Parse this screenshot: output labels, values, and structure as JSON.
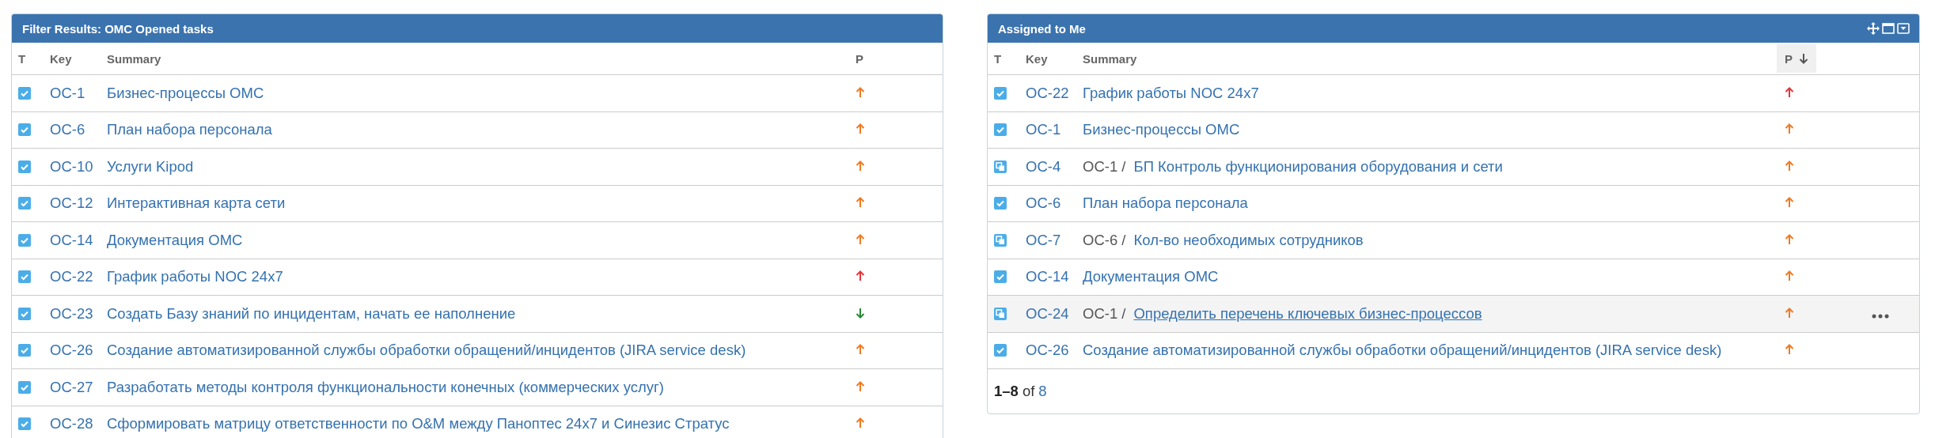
{
  "panels": [
    {
      "title": "Filter Results: OMC Opened tasks",
      "columns": [
        {
          "label": "T",
          "sorted": false
        },
        {
          "label": "Key",
          "sorted": false
        },
        {
          "label": "Summary",
          "sorted": false
        },
        {
          "label": "P",
          "sorted": false
        }
      ],
      "rows": [
        {
          "kind": "task",
          "key": "OC-1",
          "summary": "Бизнес-процессы OMC",
          "priority": {
            "kind": "up",
            "color": "#f07a22"
          },
          "hovered": false
        },
        {
          "kind": "task",
          "key": "OC-6",
          "summary": "План набора персонала",
          "priority": {
            "kind": "up",
            "color": "#f07a22"
          },
          "hovered": false
        },
        {
          "kind": "task",
          "key": "OC-10",
          "summary": "Услуги Kipod",
          "priority": {
            "kind": "up",
            "color": "#f07a22"
          },
          "hovered": false
        },
        {
          "kind": "task",
          "key": "OC-12",
          "summary": "Интерактивная карта сети",
          "priority": {
            "kind": "up",
            "color": "#f07a22"
          },
          "hovered": false
        },
        {
          "kind": "task",
          "key": "OC-14",
          "summary": "Документация OMC",
          "priority": {
            "kind": "up",
            "color": "#f07a22"
          },
          "hovered": false
        },
        {
          "kind": "task",
          "key": "OC-22",
          "summary": "График работы NOC 24x7",
          "priority": {
            "kind": "up",
            "color": "#e5343a"
          },
          "hovered": false
        },
        {
          "kind": "task",
          "key": "OC-23",
          "summary": "Создать Базу знаний по инцидентам, начать ее наполнение",
          "priority": {
            "kind": "down",
            "color": "#2a8735"
          },
          "hovered": false
        },
        {
          "kind": "task",
          "key": "OC-26",
          "summary": "Создание автоматизированной службы обработки обращений/инцидентов (JIRA service desk)",
          "priority": {
            "kind": "up",
            "color": "#f07a22"
          },
          "hovered": false
        },
        {
          "kind": "task",
          "key": "OC-27",
          "summary": "Разработать методы контроля функциональности конечных (коммерческих услуг)",
          "priority": {
            "kind": "up",
            "color": "#f07a22"
          },
          "hovered": false
        },
        {
          "kind": "task",
          "key": "OC-28",
          "summary": "Сформировать матрицу ответственности по O&M между Паноптес 24x7 и Синезис Стратус",
          "priority": {
            "kind": "up",
            "color": "#f07a22"
          },
          "hovered": false
        }
      ]
    },
    {
      "title": "Assigned to Me",
      "header_icons": [
        {
          "kind": "move"
        },
        {
          "kind": "maximize"
        },
        {
          "kind": "dropdown"
        }
      ],
      "columns": [
        {
          "label": "T",
          "sorted": false
        },
        {
          "label": "Key",
          "sorted": false
        },
        {
          "label": "Summary",
          "sorted": false
        },
        {
          "label": "P",
          "sorted": true
        }
      ],
      "rows": [
        {
          "kind": "task",
          "key": "OC-22",
          "summary": "График работы NOC 24x7",
          "priority": {
            "kind": "up",
            "color": "#e5343a"
          },
          "hovered": false
        },
        {
          "kind": "task",
          "key": "OC-1",
          "summary": "Бизнес-процессы OMC",
          "priority": {
            "kind": "up",
            "color": "#f07a22"
          },
          "hovered": false
        },
        {
          "kind": "subtask",
          "parent": "OC-1 /",
          "key": "OC-4",
          "summary": "БП Контроль функционирования оборудования и сети",
          "priority": {
            "kind": "up",
            "color": "#f07a22"
          },
          "hovered": false
        },
        {
          "kind": "task",
          "key": "OC-6",
          "summary": "План набора персонала",
          "priority": {
            "kind": "up",
            "color": "#f07a22"
          },
          "hovered": false
        },
        {
          "kind": "subtask",
          "parent": "OC-6 /",
          "key": "OC-7",
          "summary": "Кол-во необходимых сотрудников",
          "priority": {
            "kind": "up",
            "color": "#f07a22"
          },
          "hovered": false
        },
        {
          "kind": "task",
          "key": "OC-14",
          "summary": "Документация OMC",
          "priority": {
            "kind": "up",
            "color": "#f07a22"
          },
          "hovered": false
        },
        {
          "kind": "subtask",
          "parent": "OC-1 /",
          "key": "OC-24",
          "summary": "Определить перечень ключевых бизнес-процессов",
          "priority": {
            "kind": "up",
            "color": "#f07a22"
          },
          "hovered": true
        },
        {
          "kind": "task",
          "key": "OC-26",
          "summary": "Создание автоматизированной службы обработки обращений/инцидентов (JIRA service desk)",
          "priority": {
            "kind": "up",
            "color": "#f07a22"
          },
          "hovered": false
        }
      ],
      "pagination": {
        "range": "1–8",
        "of": "of",
        "total": "8"
      }
    }
  ]
}
